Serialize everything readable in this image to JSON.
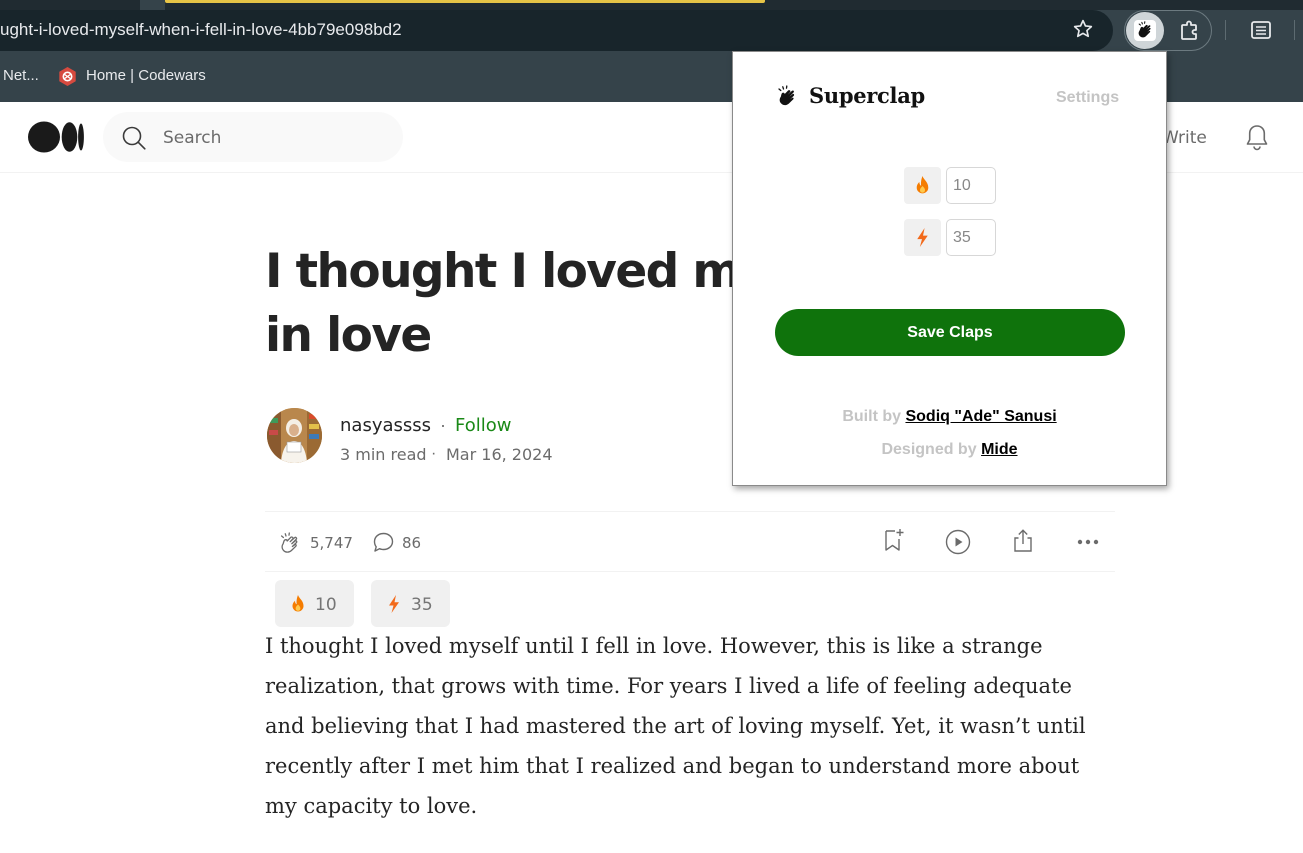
{
  "browser": {
    "url": "ught-i-loved-myself-when-i-fell-in-love-4bb79e098bd2",
    "bookmarks": [
      {
        "label": "Net..."
      },
      {
        "label": "Home | Codewars"
      }
    ],
    "icons": [
      "star-icon",
      "superclap-extension-icon",
      "extensions-puzzle-icon",
      "reading-list-icon",
      "codewars-icon"
    ],
    "colors": {
      "frame": "#35434a",
      "omnibox": "#18252b"
    }
  },
  "medium": {
    "search_placeholder": "Search",
    "write_label": "Write",
    "icons": [
      "medium-logo-icon",
      "search-icon",
      "bell-icon"
    ]
  },
  "article": {
    "title": "I thought I loved myself until I fell in love",
    "author": "nasyassss",
    "separator": "·",
    "follow_label": "Follow",
    "read_time": "3 min read",
    "date": "Mar 16, 2024",
    "claps": "5,747",
    "responses": "86",
    "chip_fire_value": "10",
    "chip_bolt_value": "35",
    "body": "I thought I loved myself until I fell in love. However, this is like a strange realization, that grows with time. For years I lived a life of feeling adequate and believing that I had mastered the art of loving myself. Yet, it wasn’t until recently after I met him that I realized and began to understand more about my capacity to love.",
    "colors": {
      "follow": "#1a8917",
      "text": "#242424",
      "muted": "#6b6b6b"
    }
  },
  "superclap": {
    "name": "Superclap",
    "settings_label": "Settings",
    "fire_value": "10",
    "bolt_value": "35",
    "save_label": "Save Claps",
    "built_by_prefix": "Built by",
    "built_by_name": "Sodiq \"Ade\" Sanusi",
    "designed_by_prefix": "Designed by",
    "designed_by_name": "Mide",
    "colors": {
      "save_button": "#0f730c",
      "fire": "#f57c00",
      "bolt": "#f26a1b",
      "muted_text": "#c4c4c4"
    }
  }
}
